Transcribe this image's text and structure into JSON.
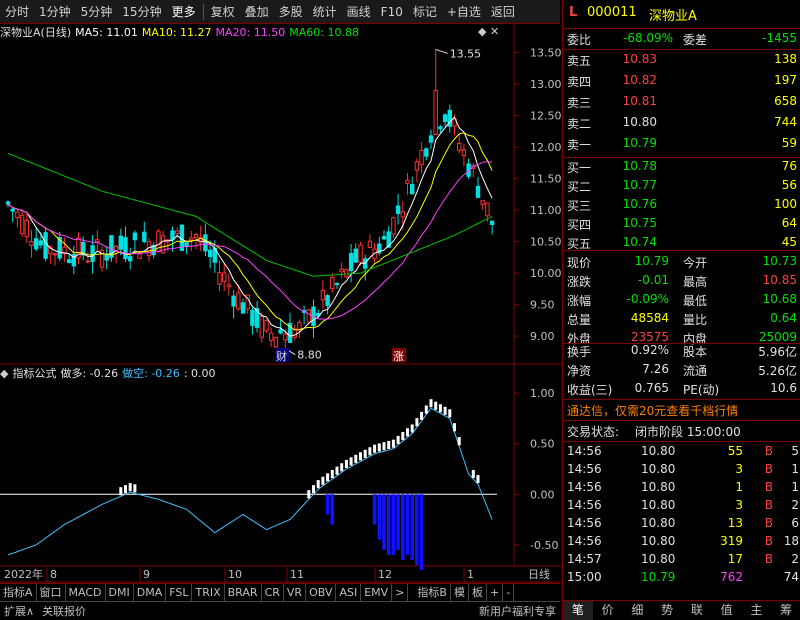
{
  "toolbar": {
    "items": [
      "分时",
      "1分钟",
      "5分钟",
      "15分钟",
      "更多",
      "复权",
      "叠加",
      "多股",
      "统计",
      "画线",
      "F10",
      "标记",
      "+自选",
      "返回"
    ]
  },
  "chart_header": {
    "title": "深物业A(日线)",
    "ma5": "MA5: 11.01",
    "ma10": "MA10: 11.27",
    "ma20": "MA20: 11.50",
    "ma60": "MA60: 10.88",
    "icons": "◆ ✕"
  },
  "price_axis": [
    "13.50",
    "13.00",
    "12.50",
    "12.00",
    "11.50",
    "11.00",
    "10.50",
    "10.00",
    "9.50",
    "9.00"
  ],
  "annotations": {
    "high": "13.55",
    "low": "8.80",
    "marker_cai": "财",
    "marker_zhang": "涨"
  },
  "indicator_header": {
    "name": "指标公式",
    "long_label": "做多: -0.26",
    "short_label": "做空: -0.26",
    "tail": ": 0.00"
  },
  "indicator_axis": [
    "1.00",
    "0.50",
    "0.00",
    "-0.50"
  ],
  "date_axis": {
    "year": "2022年",
    "months": [
      "8",
      "9",
      "10",
      "11",
      "12",
      "1"
    ]
  },
  "tabs": [
    "指标A",
    "窗口",
    "MACD",
    "DMI",
    "DMA",
    "FSL",
    "TRIX",
    "BRAR",
    "CR",
    "VR",
    "OBV",
    "ASI",
    "EMV",
    ">",
    "指标B",
    "模",
    "板",
    "+",
    "-"
  ],
  "status_bar": {
    "left": [
      "扩展∧",
      "关联报价"
    ],
    "right": "新用户福利专享"
  },
  "right_panel": {
    "flag": "L",
    "code": "000011",
    "name": "深物业A",
    "weibi_label": "委比",
    "weibi": "-68.09%",
    "weicha_label": "委差",
    "weicha": "-1455",
    "asks": [
      {
        "label": "卖五",
        "price": "10.83",
        "vol": "138"
      },
      {
        "label": "卖四",
        "price": "10.82",
        "vol": "197"
      },
      {
        "label": "卖三",
        "price": "10.81",
        "vol": "658"
      },
      {
        "label": "卖二",
        "price": "10.80",
        "vol": "744"
      },
      {
        "label": "卖一",
        "price": "10.79",
        "vol": "59"
      }
    ],
    "bids": [
      {
        "label": "买一",
        "price": "10.78",
        "vol": "76"
      },
      {
        "label": "买二",
        "price": "10.77",
        "vol": "56"
      },
      {
        "label": "买三",
        "price": "10.76",
        "vol": "100"
      },
      {
        "label": "买四",
        "price": "10.75",
        "vol": "64"
      },
      {
        "label": "买五",
        "price": "10.74",
        "vol": "45"
      }
    ],
    "stats": [
      {
        "l1": "现价",
        "v1": "10.79",
        "l2": "今开",
        "v2": "10.73"
      },
      {
        "l1": "涨跌",
        "v1": "-0.01",
        "l2": "最高",
        "v2": "10.85"
      },
      {
        "l1": "涨幅",
        "v1": "-0.09%",
        "l2": "最低",
        "v2": "10.68"
      },
      {
        "l1": "总量",
        "v1": "48584",
        "l2": "量比",
        "v2": "0.64"
      },
      {
        "l1": "外盘",
        "v1": "23575",
        "l2": "内盘",
        "v2": "25009"
      }
    ],
    "stats2": [
      {
        "l1": "换手",
        "v1": "0.92%",
        "l2": "股本",
        "v2": "5.96亿"
      },
      {
        "l1": "净资",
        "v1": "7.26",
        "l2": "流通",
        "v2": "5.26亿"
      },
      {
        "l1": "收益(三)",
        "v1": "0.765",
        "l2": "PE(动)",
        "v2": "10.6"
      }
    ],
    "promo": "通达信，仅需20元查看千档行情",
    "trade_state_label": "交易状态:",
    "trade_state": "闭市阶段 15:00:00",
    "ticks": [
      {
        "time": "14:56",
        "price": "10.80",
        "vol": "55",
        "dir": "B",
        "n": "5"
      },
      {
        "time": "14:56",
        "price": "10.80",
        "vol": "3",
        "dir": "B",
        "n": "1"
      },
      {
        "time": "14:56",
        "price": "10.80",
        "vol": "1",
        "dir": "B",
        "n": "1"
      },
      {
        "time": "14:56",
        "price": "10.80",
        "vol": "3",
        "dir": "B",
        "n": "2"
      },
      {
        "time": "14:56",
        "price": "10.80",
        "vol": "13",
        "dir": "B",
        "n": "6"
      },
      {
        "time": "14:56",
        "price": "10.80",
        "vol": "319",
        "dir": "B",
        "n": "18"
      },
      {
        "time": "14:57",
        "price": "10.80",
        "vol": "17",
        "dir": "B",
        "n": "2"
      },
      {
        "time": "15:00",
        "price": "10.79",
        "vol": "762",
        "dir": "",
        "n": "74"
      }
    ],
    "bottom_tabs": [
      "笔",
      "价",
      "细",
      "势",
      "联",
      "值",
      "主",
      "筹"
    ],
    "period": "日线"
  },
  "colors": {
    "up": "#ff3030",
    "down": "#00e0e0",
    "ma5": "#ffffff",
    "ma10": "#ffff00",
    "ma20": "#ff40ff",
    "ma60": "#00c000",
    "indicator": "#40c0ff",
    "bar": "#1010ff"
  },
  "chart_data": {
    "type": "candlestick",
    "axis_unit": "price",
    "ylim": [
      8.7,
      13.7
    ],
    "high": 13.55,
    "low": 8.8,
    "series": [
      {
        "name": "MA5",
        "value": 11.01
      },
      {
        "name": "MA10",
        "value": 11.27
      },
      {
        "name": "MA20",
        "value": 11.5
      },
      {
        "name": "MA60",
        "value": 10.88
      }
    ],
    "indicator": {
      "ylim": [
        -0.65,
        1.1
      ],
      "long": -0.26,
      "short": -0.26
    }
  }
}
